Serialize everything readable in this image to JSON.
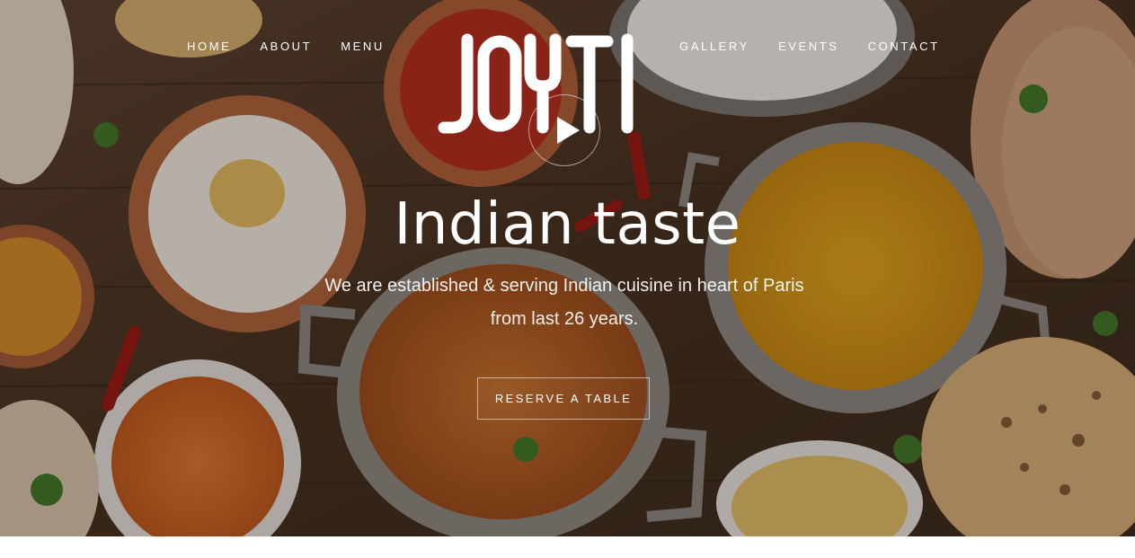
{
  "brand": {
    "logo_text": "JOYTI"
  },
  "nav": {
    "left_items": [
      {
        "label": "HOME"
      },
      {
        "label": "ABOUT"
      },
      {
        "label": "MENU"
      }
    ],
    "right_items": [
      {
        "label": "GALLERY"
      },
      {
        "label": "EVENTS"
      },
      {
        "label": "CONTACT"
      }
    ]
  },
  "hero": {
    "headline": "Indian taste",
    "tagline_line1": "We are established & serving Indian cuisine in heart of Paris",
    "tagline_line2": "from last 26 years.",
    "cta_label": "RESERVE A TABLE",
    "play_icon": "play-icon"
  },
  "colors": {
    "text": "#ffffff",
    "wood": "#4a3426",
    "page_background": "#ffffff"
  }
}
